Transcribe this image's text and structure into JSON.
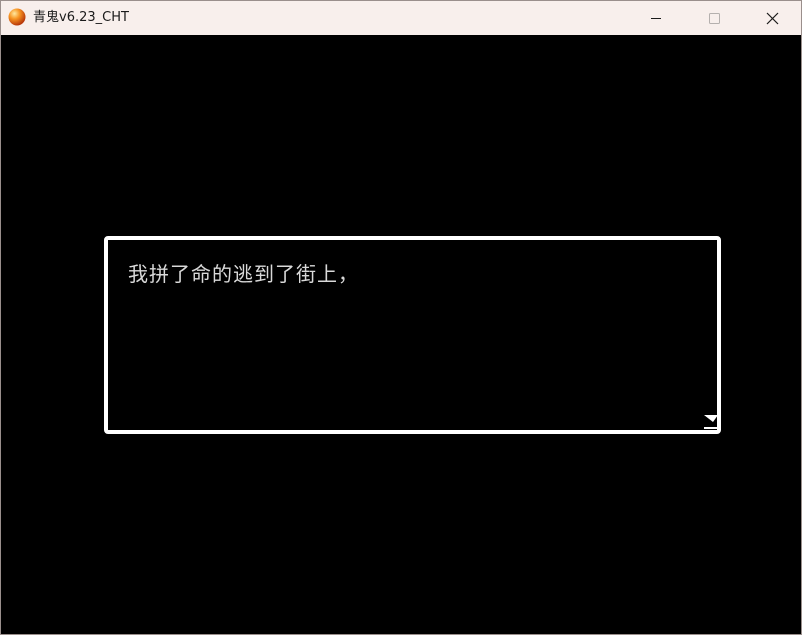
{
  "window": {
    "title": "青鬼v6.23_CHT",
    "app_icon": "orange-orb-icon",
    "controls": {
      "minimize_icon": "minimize-icon",
      "maximize_icon": "maximize-icon",
      "close_icon": "close-icon"
    }
  },
  "dialog": {
    "text": "我拼了命的逃到了街上，",
    "continue_icon": "continue-arrow-icon"
  },
  "colors": {
    "titlebar_bg": "#f8efec",
    "game_bg": "#000000",
    "dialog_border": "#ffffff",
    "dialog_text": "#d9d9d9"
  }
}
